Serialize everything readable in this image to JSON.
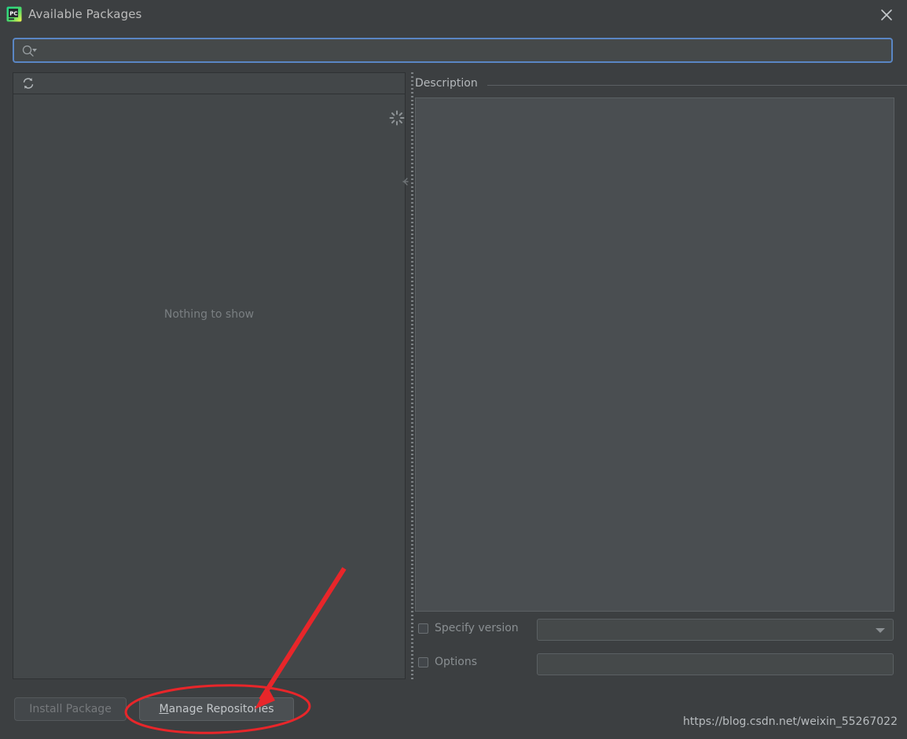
{
  "window": {
    "title": "Available Packages",
    "app_icon": "pycharm-icon",
    "close_icon": "close-icon"
  },
  "search": {
    "icon": "search-icon",
    "value": "",
    "placeholder": ""
  },
  "packages_panel": {
    "refresh_icon": "refresh-icon",
    "spinner_icon": "loading-spinner-icon",
    "empty_text": "Nothing to show"
  },
  "splitter": {
    "collapse_icon": "collapse-left-icon"
  },
  "description": {
    "label": "Description",
    "content": ""
  },
  "options": {
    "specify_version": {
      "label": "Specify version",
      "checked": false,
      "value": "",
      "dropdown_icon": "chevron-down-icon"
    },
    "options_field": {
      "label": "Options",
      "checked": false,
      "value": ""
    }
  },
  "buttons": {
    "install": "Install Package",
    "manage_prefix": "",
    "manage_mnemonic": "M",
    "manage_suffix": "anage Repositories"
  },
  "watermark": "https://blog.csdn.net/weixin_55267022",
  "colors": {
    "window_bg": "#3c3f41",
    "panel_bg": "#434749",
    "desc_bg": "#4a4e51",
    "focus_blue": "#5a86c4",
    "text": "#bbbbbb",
    "muted_text": "#7a7f82",
    "annotation_red": "#e8262a"
  }
}
